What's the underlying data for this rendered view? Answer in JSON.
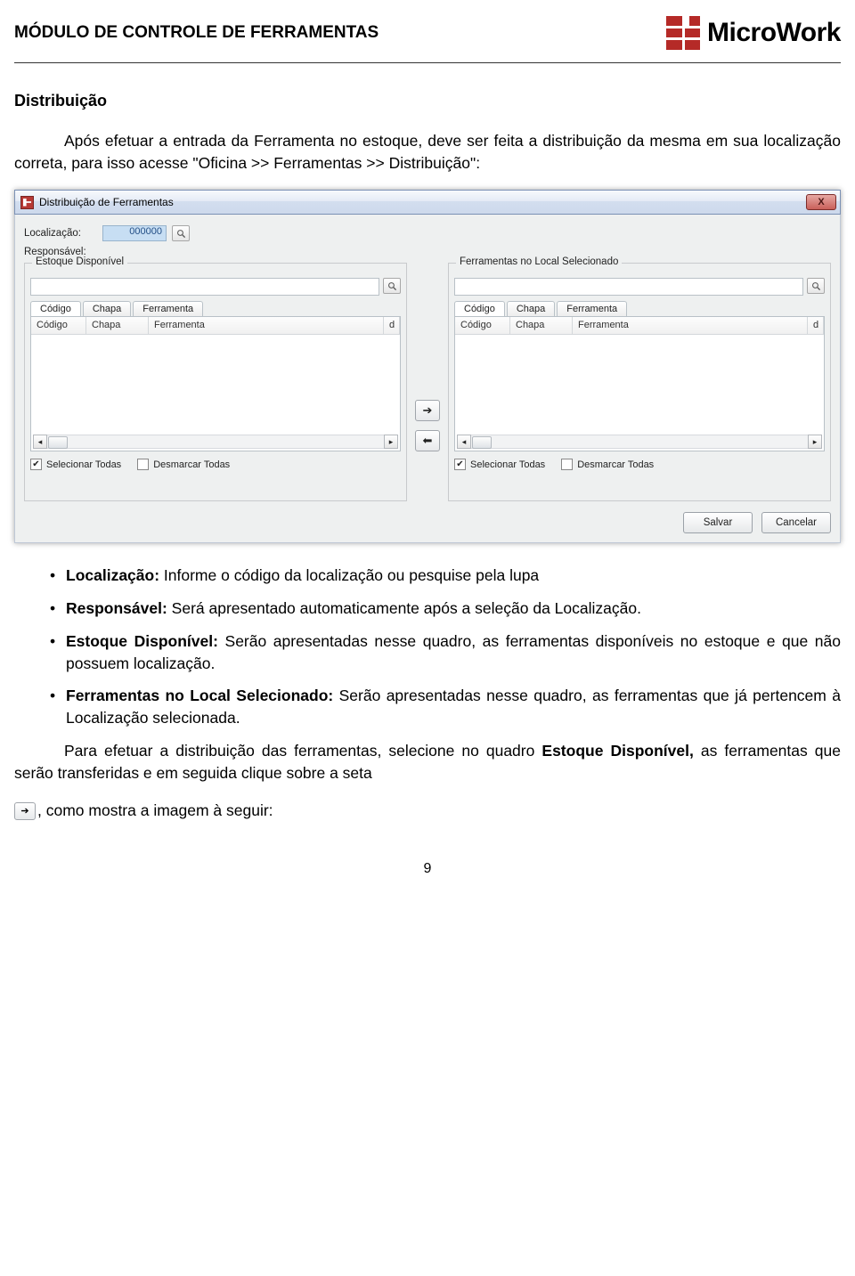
{
  "header": {
    "page_title": "MÓDULO DE CONTROLE DE FERRAMENTAS",
    "brand_main": "Micro",
    "brand_sub": "Work"
  },
  "section": {
    "heading": "Distribuição",
    "intro": "Após efetuar a entrada da Ferramenta no estoque, deve ser feita a distribuição da mesma em sua localização correta, para isso acesse \"Oficina >> Ferramentas >> Distribuição\":"
  },
  "dialog": {
    "title": "Distribuição de Ferramentas",
    "close": "X",
    "fields": {
      "localizacao_label": "Localização:",
      "localizacao_value": "000000",
      "responsavel_label": "Responsável:"
    },
    "left_panel": {
      "legend": "Estoque Disponível",
      "tabs": [
        "Código",
        "Chapa",
        "Ferramenta"
      ],
      "cols": {
        "codigo": "Código",
        "chapa": "Chapa",
        "ferramenta": "Ferramenta",
        "di": "d"
      },
      "sel_todas": "Selecionar Todas",
      "desm_todas": "Desmarcar Todas"
    },
    "right_panel": {
      "legend": "Ferramentas no Local Selecionado",
      "tabs": [
        "Código",
        "Chapa",
        "Ferramenta"
      ],
      "cols": {
        "codigo": "Código",
        "chapa": "Chapa",
        "ferramenta": "Ferramenta",
        "di": "d"
      },
      "sel_todas": "Selecionar Todas",
      "desm_todas": "Desmarcar Todas"
    },
    "buttons": {
      "salvar": "Salvar",
      "cancelar": "Cancelar"
    }
  },
  "bullets": {
    "b1_bold": "Localização:",
    "b1_rest": " Informe o código da localização ou pesquise pela lupa",
    "b2_bold": "Responsável:",
    "b2_rest": " Será apresentado automaticamente após a seleção da Localização.",
    "b3_bold": "Estoque Disponível:",
    "b3_rest": " Serão apresentadas nesse quadro, as ferramentas disponíveis no estoque e que não possuem localização.",
    "b4_bold": "Ferramentas no Local Selecionado:",
    "b4_rest": " Serão apresentadas nesse quadro, as ferramentas que já pertencem à Localização selecionada."
  },
  "closing": {
    "p1a": "Para efetuar a distribuição das ferramentas, selecione no quadro ",
    "p1_bold": "Estoque Disponível,",
    "p1b": " as ferramentas que serão transferidas e em seguida clique sobre a seta ",
    "p1c": ", como mostra a imagem à seguir:"
  },
  "page_number": "9"
}
